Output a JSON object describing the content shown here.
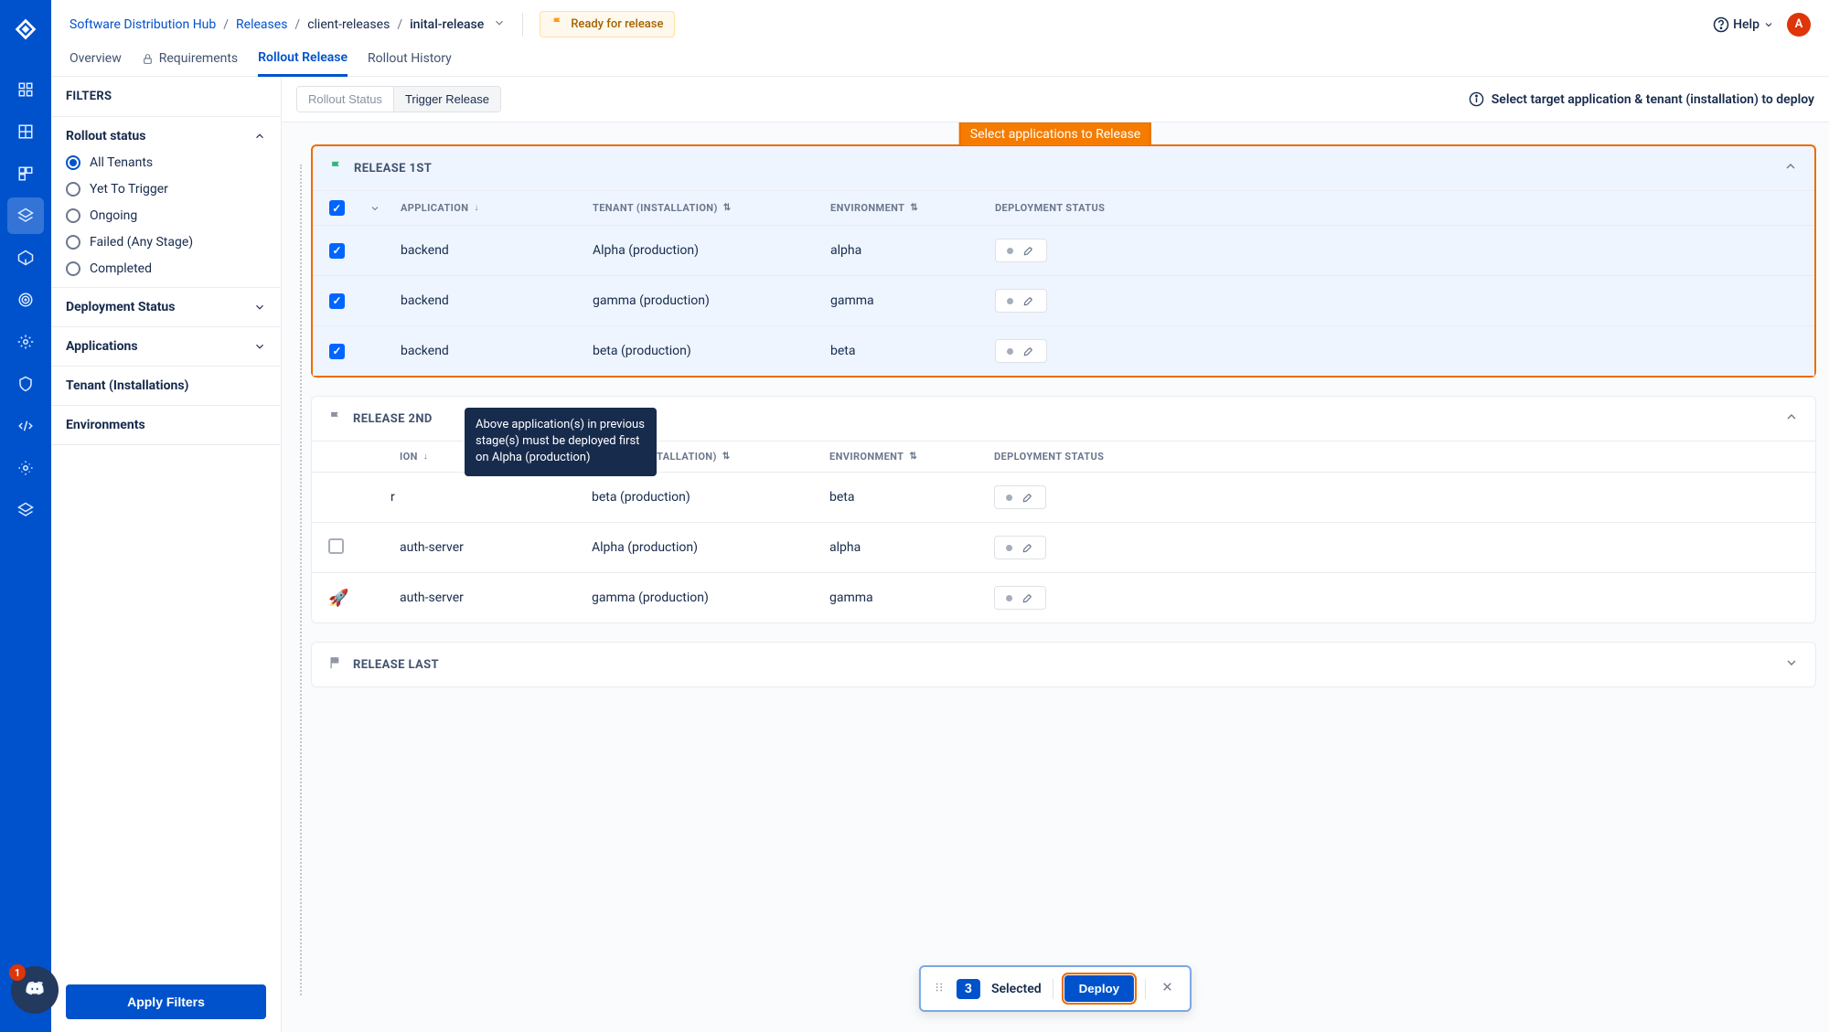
{
  "breadcrumbs": {
    "root": "Software Distribution Hub",
    "releases": "Releases",
    "bundle": "client-releases",
    "release": "inital-release"
  },
  "statusPill": "Ready for release",
  "help": "Help",
  "avatar": "A",
  "tabs": {
    "overview": "Overview",
    "requirements": "Requirements",
    "rollout": "Rollout Release",
    "history": "Rollout History"
  },
  "filters": {
    "header": "FILTERS",
    "rolloutStatus": {
      "title": "Rollout status",
      "options": {
        "all": "All Tenants",
        "yet": "Yet To Trigger",
        "ongoing": "Ongoing",
        "failed": "Failed (Any Stage)",
        "completed": "Completed"
      },
      "selected": "all"
    },
    "deploymentStatus": "Deployment Status",
    "applications": "Applications",
    "tenants": "Tenant (Installations)",
    "environments": "Environments",
    "apply": "Apply Filters"
  },
  "toolbar": {
    "rolloutStatus": "Rollout Status",
    "triggerRelease": "Trigger Release",
    "infoText": "Select target application & tenant (installation) to deploy"
  },
  "callout": "Select applications to Release",
  "columns": {
    "application": "APPLICATION",
    "tenant": "TENANT (INSTALLATION)",
    "environment": "ENVIRONMENT",
    "deployment": "DEPLOYMENT STATUS"
  },
  "groups": {
    "g1": {
      "title": "RELEASE 1ST",
      "rows": [
        {
          "app": "backend",
          "tenant": "Alpha (production)",
          "env": "alpha",
          "checked": true
        },
        {
          "app": "backend",
          "tenant": "gamma (production)",
          "env": "gamma",
          "checked": true
        },
        {
          "app": "backend",
          "tenant": "beta (production)",
          "env": "beta",
          "checked": true
        }
      ]
    },
    "g2": {
      "title": "RELEASE 2ND",
      "rows": [
        {
          "app": "auth-server",
          "tenant": "beta (production)",
          "env": "beta",
          "checked": false,
          "disabled": true,
          "iconPartial": true
        },
        {
          "app": "auth-server",
          "tenant": "Alpha (production)",
          "env": "alpha",
          "checked": false
        },
        {
          "app": "auth-server",
          "tenant": "gamma (production)",
          "env": "gamma",
          "checked": false,
          "rocket": true
        }
      ]
    },
    "g3": {
      "title": "RELEASE LAST"
    }
  },
  "tooltip": "Above application(s) in previous stage(s) must be deployed first on Alpha (production)",
  "floatbar": {
    "count": "3",
    "selected": "Selected",
    "deploy": "Deploy"
  },
  "discordBadge": "1"
}
